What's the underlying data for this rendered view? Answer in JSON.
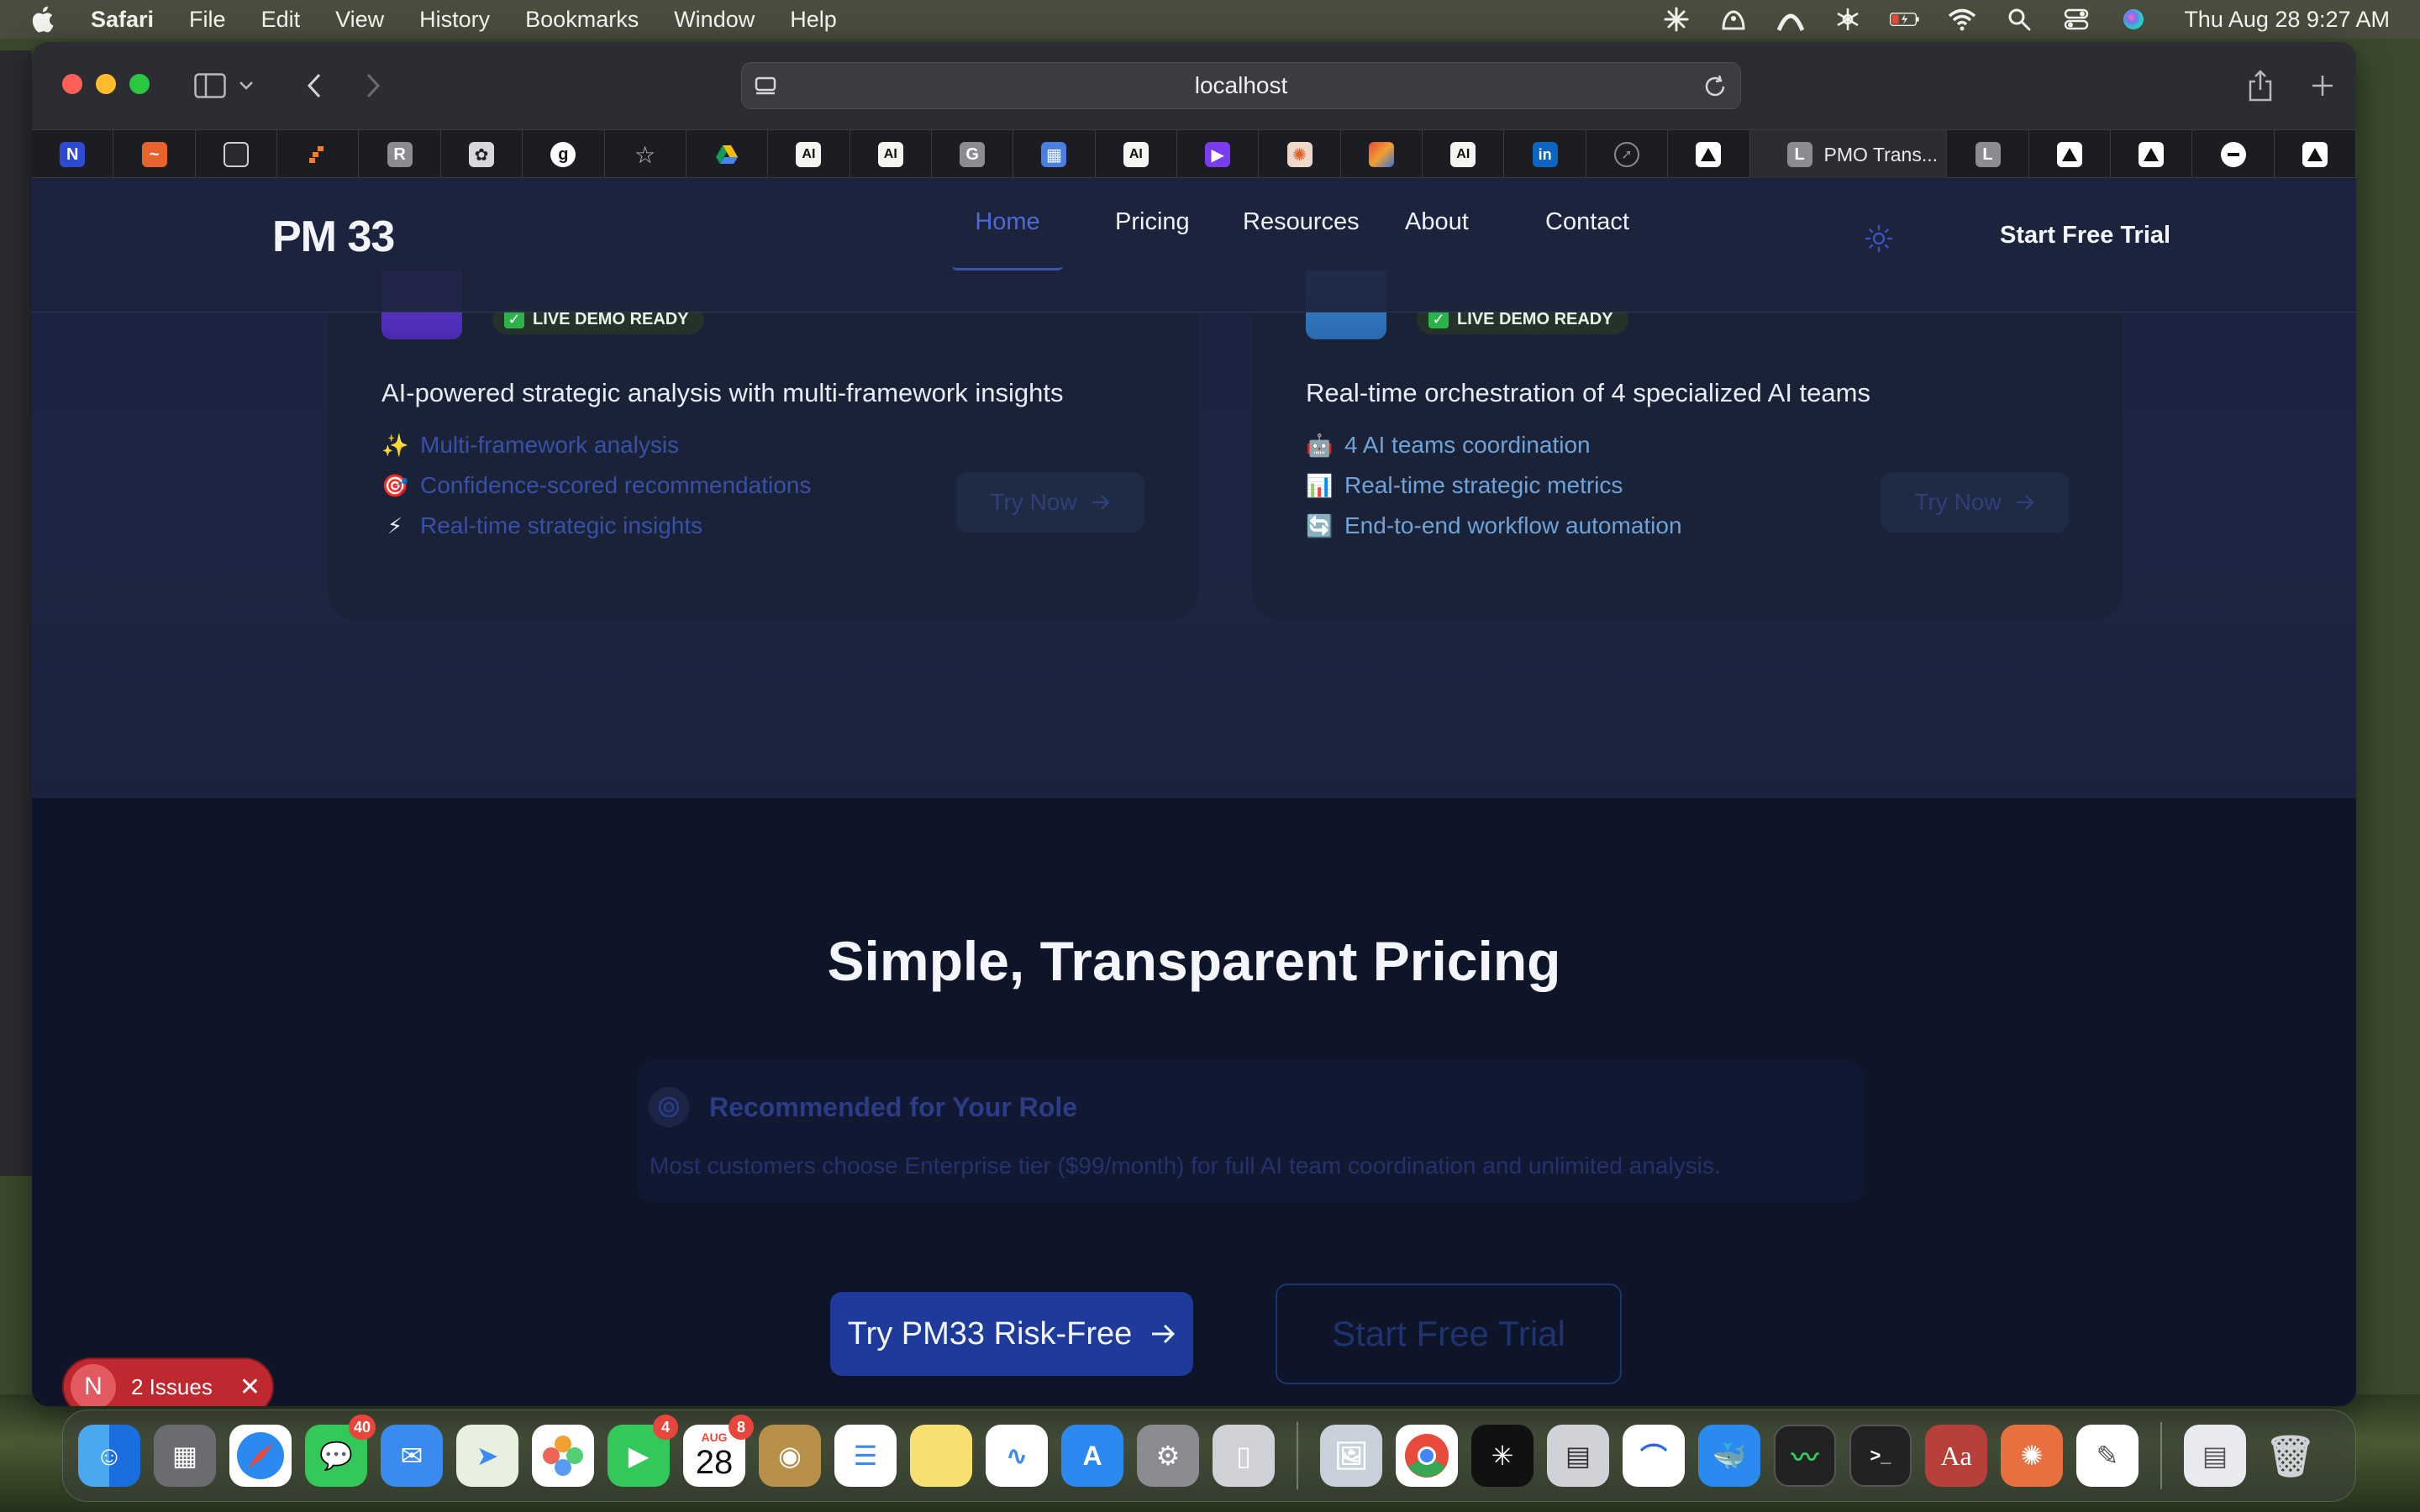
{
  "menubar": {
    "app_name": "Safari",
    "items": [
      "File",
      "Edit",
      "View",
      "History",
      "Bookmarks",
      "Window",
      "Help"
    ],
    "clock": "Thu Aug 28  9:27 AM"
  },
  "browser": {
    "url": "localhost",
    "active_tab_title": "PMO Trans...",
    "tab_letters": {
      "r": "R",
      "g": "G",
      "l": "L",
      "ai": "AI",
      "in": "in"
    }
  },
  "site": {
    "logo": "PM 33",
    "nav": {
      "home": "Home",
      "pricing": "Pricing",
      "resources": "Resources",
      "about": "About",
      "contact": "Contact",
      "cta": "Start Free Trial"
    }
  },
  "cards": [
    {
      "badge": "LIVE DEMO READY",
      "description": "AI-powered strategic analysis with multi-framework insights",
      "features": [
        {
          "emoji": "✨",
          "text": "Multi-framework analysis"
        },
        {
          "emoji": "🎯",
          "text": "Confidence-scored recommendations"
        },
        {
          "emoji": "⚡",
          "text": "Real-time strategic insights"
        }
      ],
      "button": "Try Now"
    },
    {
      "badge": "LIVE DEMO READY",
      "description": "Real-time orchestration of 4 specialized AI teams",
      "features": [
        {
          "emoji": "🤖",
          "text": "4 AI teams coordination"
        },
        {
          "emoji": "📊",
          "text": "Real-time strategic metrics"
        },
        {
          "emoji": "🔄",
          "text": "End-to-end workflow automation"
        }
      ],
      "button": "Try Now"
    }
  ],
  "pricing": {
    "title": "Simple, Transparent Pricing",
    "recommendation_title": "Recommended for Your Role",
    "recommendation_text": "Most customers choose Enterprise tier ($99/month) for full AI team coordination and unlimited analysis.",
    "primary_cta": "Try PM33 Risk-Free",
    "secondary_cta": "Start Free Trial"
  },
  "dev_overlay": {
    "letter": "N",
    "issues_label": "2 Issues"
  },
  "dock": {
    "messages_badge": "40",
    "facetime_badge": "4",
    "calendar_badge": "8",
    "calendar_month": "AUG",
    "calendar_day": "28",
    "dictionary_label": "Aa"
  }
}
